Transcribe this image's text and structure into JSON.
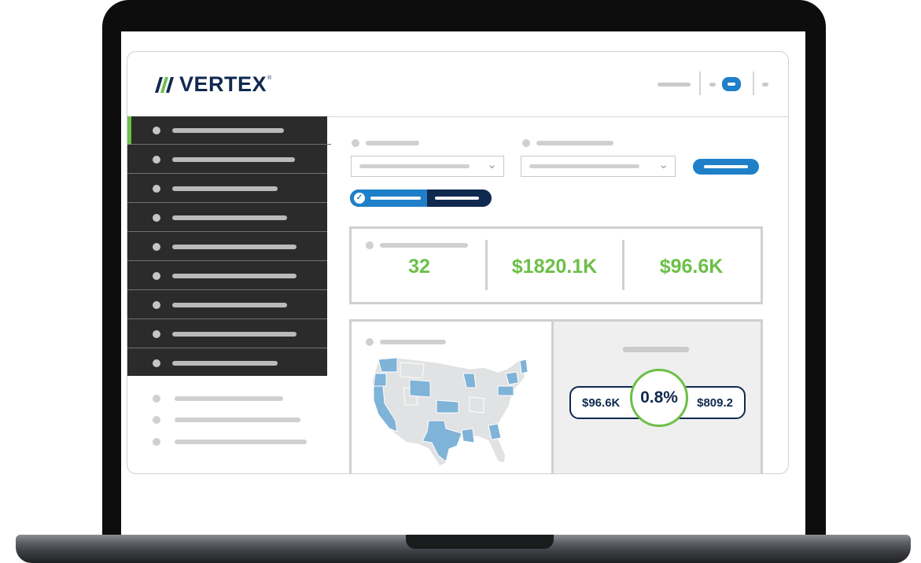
{
  "app": {
    "brand": "VERTEX",
    "brand_mark": "®"
  },
  "kpis": [
    {
      "value": "32"
    },
    {
      "value": "$1820.1K"
    },
    {
      "value": "$96.6K"
    }
  ],
  "ratio": {
    "left_value": "$96.6K",
    "center_value": "0.8%",
    "right_value": "$809.2"
  },
  "colors": {
    "brand_navy": "#10294f",
    "accent_blue": "#1f7fc9",
    "kpi_green": "#6cbf47",
    "sidebar_bg": "#2b2b2c",
    "map_state_blue": "#7fb3d8"
  },
  "map": {
    "highlighted_states": [
      "WA",
      "CA",
      "OR",
      "MT",
      "UT",
      "CO",
      "KS",
      "TX",
      "LA",
      "WI",
      "PA",
      "GA",
      "NY",
      "MA"
    ]
  },
  "icons": {
    "logo": "vertex-logo-icon",
    "dropdown": "chevron-down-icon",
    "toggle": "check-icon"
  },
  "sidebar": {
    "active_index": 0
  }
}
